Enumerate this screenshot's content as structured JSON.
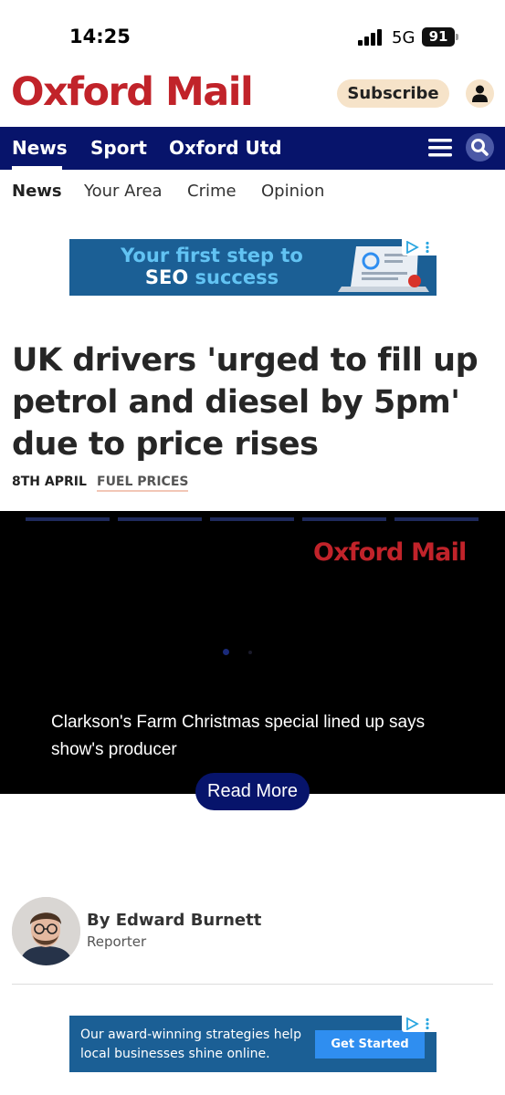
{
  "status_bar": {
    "time": "14:25",
    "network": "5G",
    "battery": "91"
  },
  "masthead": {
    "logo": "Oxford Mail",
    "subscribe_label": "Subscribe"
  },
  "primary_nav": {
    "items": [
      "News",
      "Sport",
      "Oxford Utd"
    ],
    "active": "News"
  },
  "secondary_nav": {
    "items": [
      "News",
      "Your Area",
      "Crime",
      "Opinion"
    ],
    "active": "News"
  },
  "ad_top": {
    "line1": "Your first step to",
    "line2_white": "SEO",
    "line2_blue": "success"
  },
  "article": {
    "headline": "UK drivers 'urged to fill up petrol and diesel by 5pm' due to price rises",
    "date": "8TH APRIL",
    "topic": "FUEL PRICES"
  },
  "video": {
    "logo": "Oxford Mail",
    "caption": "Clarkson's Farm Christmas special lined up says show's producer",
    "read_more_label": "Read More"
  },
  "author": {
    "name": "By Edward Burnett",
    "role": "Reporter"
  },
  "ad_bottom": {
    "text": "Our award-winning strategies help local businesses shine online.",
    "cta": "Get Started"
  },
  "colors": {
    "brand_red": "#c1232a",
    "nav_blue": "#07146b",
    "subscribe_bg": "#f6e3c9",
    "ad_blue": "#1b5f95"
  }
}
